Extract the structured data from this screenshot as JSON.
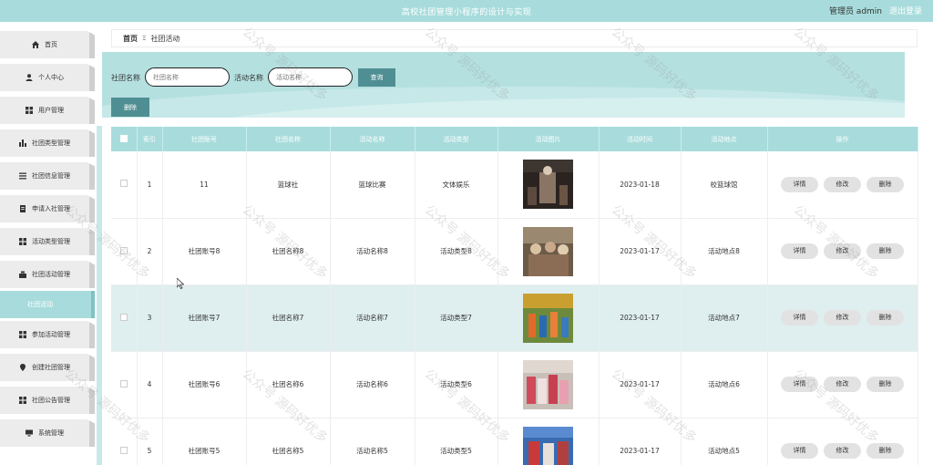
{
  "header": {
    "title": "高校社团管理小程序的设计与实现",
    "user": "管理员 admin",
    "logout": "退出登录"
  },
  "sidebar": {
    "items": [
      {
        "label": "首页",
        "icon": "home-icon"
      },
      {
        "label": "个人中心",
        "icon": "user-icon"
      },
      {
        "label": "用户管理",
        "icon": "grid-icon"
      },
      {
        "label": "社团类型管理",
        "icon": "chart-icon"
      },
      {
        "label": "社团信息管理",
        "icon": "list-icon"
      },
      {
        "label": "申请入社管理",
        "icon": "doc-icon"
      },
      {
        "label": "活动类型管理",
        "icon": "grid-icon"
      },
      {
        "label": "社团活动管理",
        "icon": "stack-icon"
      },
      {
        "label": "社团活动",
        "icon": "",
        "active": true
      },
      {
        "label": "参加活动管理",
        "icon": "grid-icon"
      },
      {
        "label": "创建社团管理",
        "icon": "pin-icon"
      },
      {
        "label": "社团公告管理",
        "icon": "grid-icon"
      },
      {
        "label": "系统管理",
        "icon": "computer-icon"
      }
    ]
  },
  "breadcrumb": {
    "home": "首页",
    "separator": "Ξ",
    "current": "社团活动"
  },
  "search": {
    "club_label": "社团名称",
    "club_placeholder": "社团名称",
    "activity_label": "活动名称",
    "activity_placeholder": "活动名称",
    "query_button": "查询",
    "delete_button": "删除"
  },
  "table": {
    "headers": [
      "索引",
      "社团账号",
      "社团名称",
      "活动名称",
      "活动类型",
      "活动图片",
      "活动时间",
      "活动地点",
      "操作"
    ],
    "actions": {
      "detail": "详情",
      "edit": "修改",
      "delete": "删除"
    },
    "rows": [
      {
        "index": "1",
        "account": "11",
        "club": "篮球社",
        "activity": "篮球比赛",
        "type": "文体娱乐",
        "date": "2023-01-18",
        "place": "校篮球馆"
      },
      {
        "index": "2",
        "account": "社团账号8",
        "club": "社团名称8",
        "activity": "活动名称8",
        "type": "活动类型8",
        "date": "2023-01-17",
        "place": "活动地点8"
      },
      {
        "index": "3",
        "account": "社团账号7",
        "club": "社团名称7",
        "activity": "活动名称7",
        "type": "活动类型7",
        "date": "2023-01-17",
        "place": "活动地点7"
      },
      {
        "index": "4",
        "account": "社团账号6",
        "club": "社团名称6",
        "activity": "活动名称6",
        "type": "活动类型6",
        "date": "2023-01-17",
        "place": "活动地点6"
      },
      {
        "index": "5",
        "account": "社团账号5",
        "club": "社团名称5",
        "activity": "活动名称5",
        "type": "活动类型5",
        "date": "2023-01-17",
        "place": "活动地点5"
      }
    ]
  },
  "watermark": "公众号 源码好优多",
  "colors": {
    "accent": "#a8dcdc",
    "button": "#4f8f93"
  }
}
